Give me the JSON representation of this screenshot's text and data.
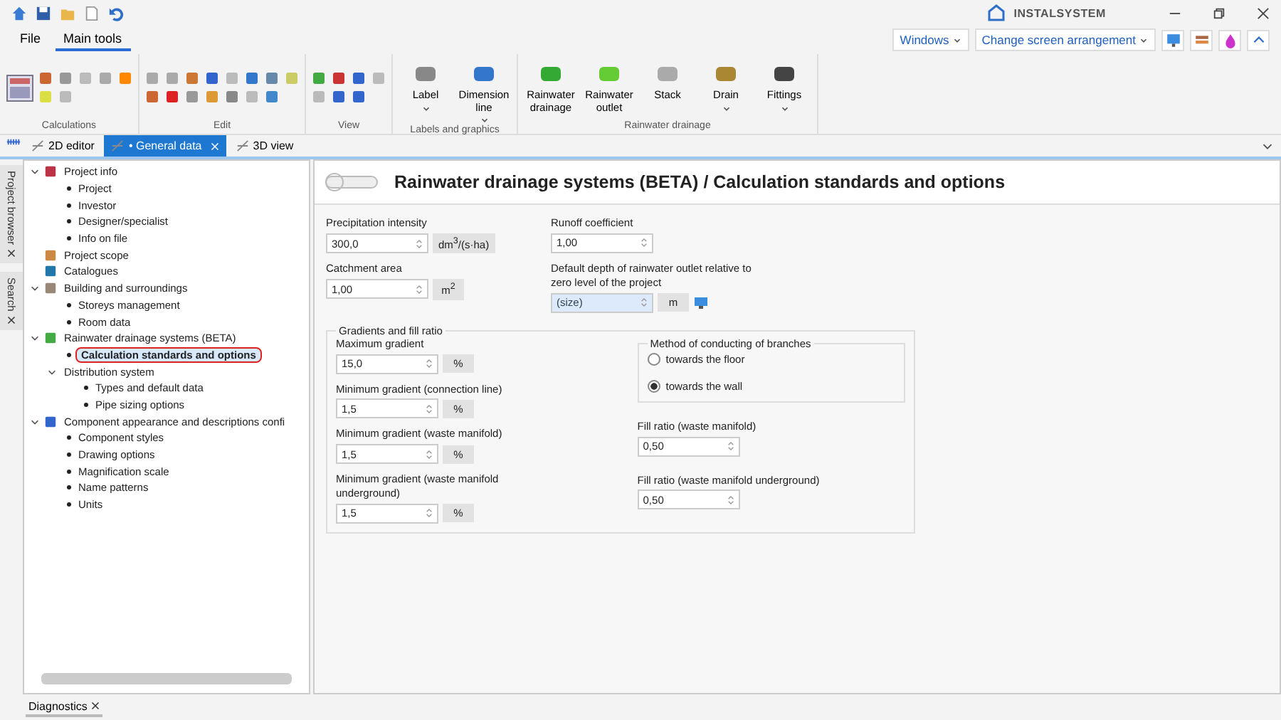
{
  "menu_tabs": [
    {
      "label": "File",
      "selected": false
    },
    {
      "label": "Main tools",
      "selected": true
    }
  ],
  "brand": "INSTALSYSTEM",
  "top_buttons": [
    "Windows",
    "Change screen arrangement"
  ],
  "ribbon": {
    "groups": [
      {
        "label": "Calculations",
        "kind": "small"
      },
      {
        "label": "Edit",
        "kind": "small"
      },
      {
        "label": "View",
        "kind": "small"
      },
      {
        "label": "Labels and graphics",
        "kind": "large",
        "buttons": [
          {
            "label": "Label",
            "dropdown": true
          },
          {
            "label": "Dimension line",
            "dropdown": true
          }
        ]
      },
      {
        "label": "Rainwater drainage",
        "kind": "large",
        "buttons": [
          {
            "label": "Rainwater drainage",
            "dropdown": false
          },
          {
            "label": "Rainwater outlet",
            "dropdown": false
          },
          {
            "label": "Stack",
            "dropdown": false
          },
          {
            "label": "Drain",
            "dropdown": true
          },
          {
            "label": "Fittings",
            "dropdown": true
          }
        ]
      }
    ]
  },
  "doc_tabs": [
    {
      "label": "2D editor",
      "selected": false
    },
    {
      "label": "• General data",
      "selected": true
    },
    {
      "label": "3D view",
      "selected": false
    }
  ],
  "side_tabs": [
    "Project browser",
    "Search"
  ],
  "tree": [
    {
      "label": "Project info",
      "kind": "section",
      "selected": false,
      "expanded": true,
      "children": [
        {
          "label": "Project",
          "kind": "leaf",
          "selected": false
        },
        {
          "label": "Investor",
          "kind": "leaf",
          "selected": false
        },
        {
          "label": "Designer/specialist",
          "kind": "leaf",
          "selected": false
        },
        {
          "label": "Info on file",
          "kind": "leaf",
          "selected": false
        }
      ]
    },
    {
      "label": "Project scope",
      "kind": "section",
      "selected": false
    },
    {
      "label": "Catalogues",
      "kind": "section",
      "selected": false
    },
    {
      "label": "Building and surroundings",
      "kind": "section",
      "selected": false,
      "expanded": true,
      "children": [
        {
          "label": "Storeys management",
          "kind": "leaf",
          "selected": false
        },
        {
          "label": "Room data",
          "kind": "leaf",
          "selected": false
        }
      ]
    },
    {
      "label": "Rainwater drainage systems (BETA)",
      "kind": "section",
      "selected": false,
      "expanded": true,
      "children": [
        {
          "label": "Calculation standards and options",
          "kind": "leaf",
          "selected": true
        },
        {
          "label": "Distribution system",
          "kind": "group",
          "selected": false,
          "expanded": true,
          "children": [
            {
              "label": "Types and default data",
              "kind": "leaf",
              "selected": false
            },
            {
              "label": "Pipe sizing options",
              "kind": "leaf",
              "selected": false
            }
          ]
        }
      ]
    },
    {
      "label": "Component appearance and descriptions confi",
      "kind": "section",
      "selected": false,
      "expanded": true,
      "children": [
        {
          "label": "Component styles",
          "kind": "leaf",
          "selected": false
        },
        {
          "label": "Drawing options",
          "kind": "leaf",
          "selected": false
        },
        {
          "label": "Magnification scale",
          "kind": "leaf",
          "selected": false
        },
        {
          "label": "Name patterns",
          "kind": "leaf",
          "selected": false
        },
        {
          "label": "Units",
          "kind": "leaf",
          "selected": false
        }
      ]
    }
  ],
  "page_title": "Rainwater drainage systems (BETA) / Calculation standards and options",
  "top_fields": [
    {
      "label": "Precipitation intensity",
      "value": "300,0",
      "unit": "dm$^{3}$/(s·ha)",
      "highlighted": false,
      "picker": false
    },
    {
      "label": "Runoff coefficient",
      "value": "1,00",
      "highlighted": false,
      "picker": false
    },
    {
      "label": "Catchment area",
      "value": "1,00",
      "unit": "m$^{2}$",
      "highlighted": false,
      "picker": false
    },
    {
      "label": "Default depth of rainwater outlet relative to zero level of the project",
      "value": "(size)",
      "unit": "m",
      "highlighted": true,
      "picker": true
    }
  ],
  "gradients": {
    "title": "Gradients and fill ratio",
    "left_fields": [
      {
        "label": "Maximum gradient",
        "value": "15,0",
        "unit": "%"
      },
      {
        "label": "Minimum gradient (connection line)",
        "value": "1,5",
        "unit": "%"
      },
      {
        "label": "Minimum gradient (waste manifold)",
        "value": "1,5",
        "unit": "%"
      },
      {
        "label": "Minimum gradient (waste manifold underground)",
        "value": "1,5",
        "unit": "%"
      }
    ],
    "method": {
      "title": "Method of conducting of branches",
      "options": [
        {
          "label": "towards the floor",
          "selected": false
        },
        {
          "label": "towards the wall",
          "selected": true
        }
      ]
    },
    "right_fields": [
      {
        "label": "Fill ratio (waste manifold)",
        "value": "0,50"
      },
      {
        "label": "Fill ratio (waste manifold underground)",
        "value": "0,50"
      }
    ]
  },
  "bottom_tab": "Diagnostics"
}
